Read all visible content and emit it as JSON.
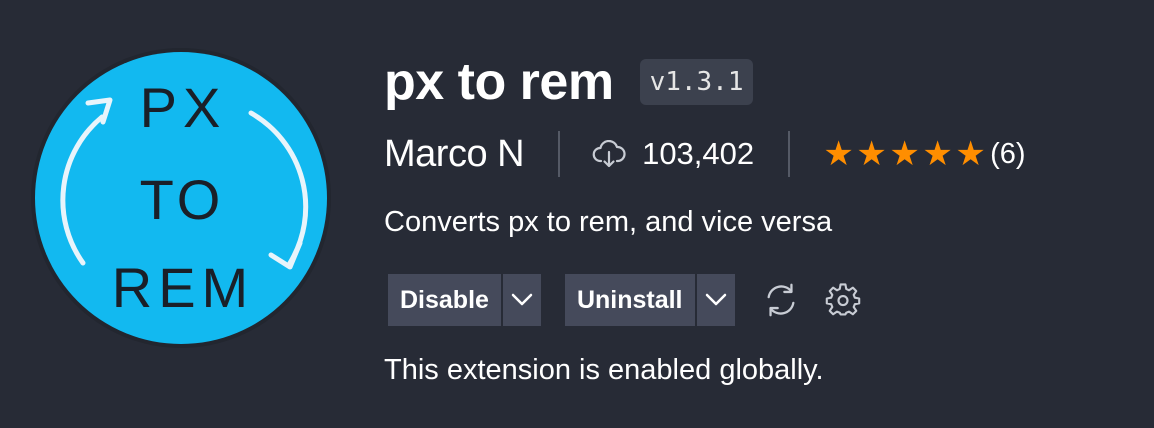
{
  "extension": {
    "name": "px to rem",
    "version": "v1.3.1",
    "publisher": "Marco N",
    "install_count": "103,402",
    "rating_value": 5,
    "rating_count": "(6)",
    "description": "Converts px to rem, and vice versa",
    "status": "This extension is enabled globally.",
    "icon_text": {
      "line1": "PX",
      "line2": "TO",
      "line3": "REM"
    }
  },
  "actions": {
    "disable_label": "Disable",
    "uninstall_label": "Uninstall"
  },
  "icons": {
    "installs": "cloud-download-icon",
    "stars": "star-icon",
    "sync": "sync-icon",
    "settings": "gear-icon",
    "dropdown": "chevron-down-icon"
  },
  "colors": {
    "background": "#272b36",
    "icon_circle": "#12b9f0",
    "star": "#ff8e00",
    "button_bg": "#454a5b",
    "badge_bg": "#3c414e"
  }
}
